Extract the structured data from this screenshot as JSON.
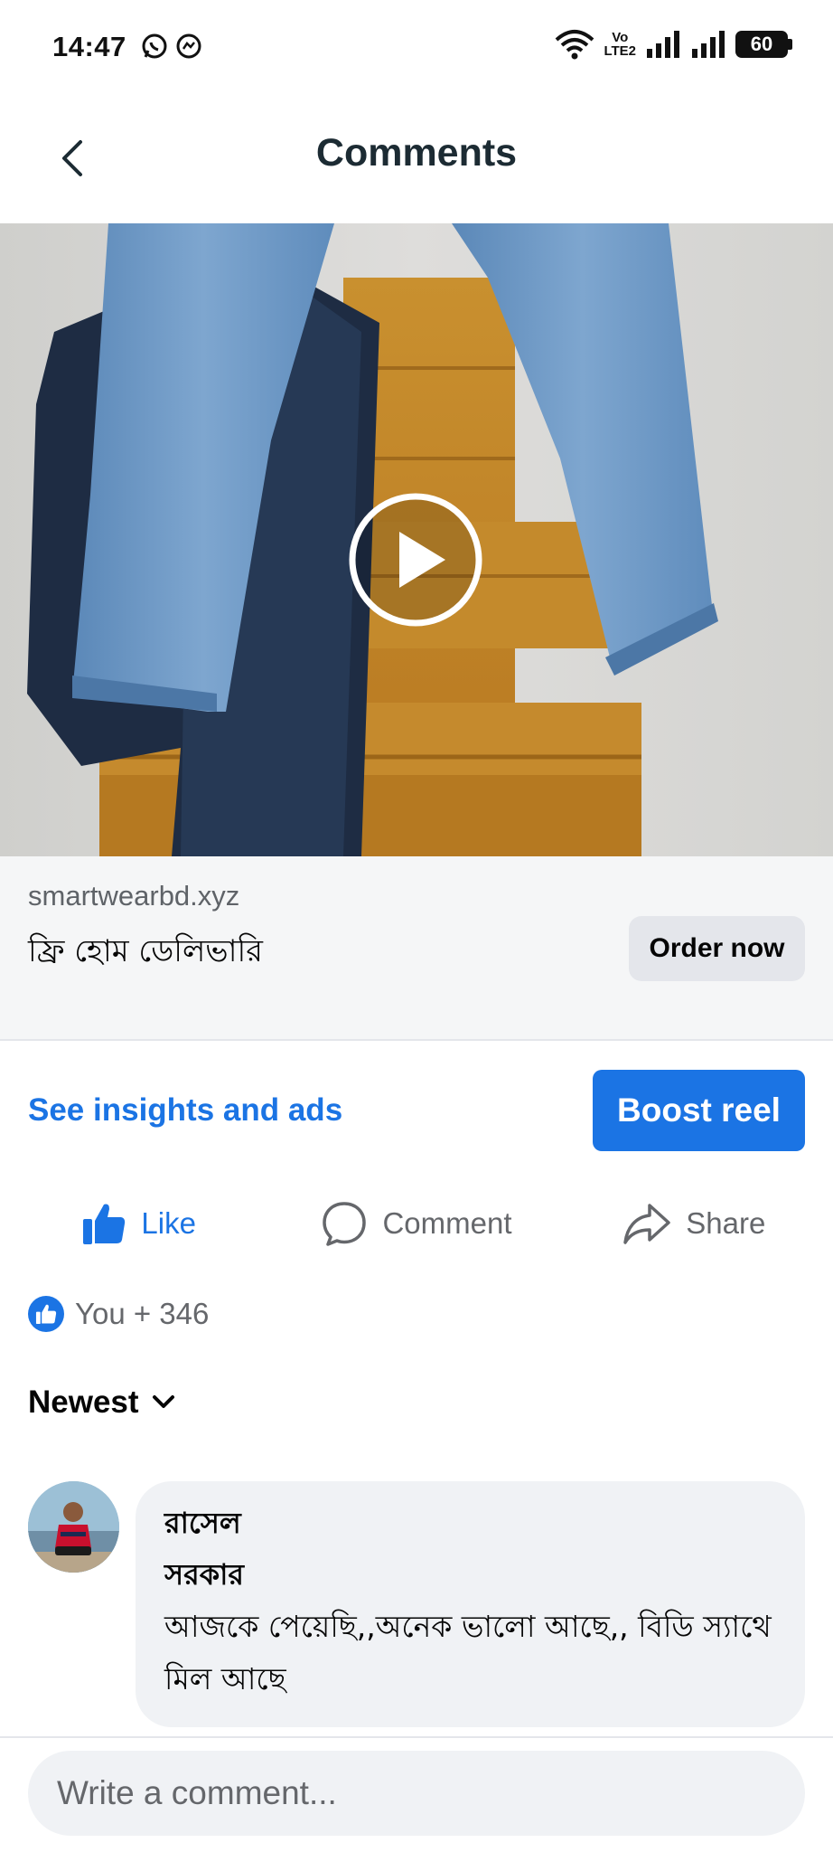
{
  "status_bar": {
    "time": "14:47",
    "volte_top": "Vo",
    "volte_bottom": "LTE2",
    "battery": "60"
  },
  "header": {
    "title": "Comments"
  },
  "ad": {
    "domain": "smartwearbd.xyz",
    "headline": "ফ্রি হোম ডেলিভারি",
    "cta": "Order now"
  },
  "insights": {
    "link": "See insights and ads",
    "boost": "Boost reel"
  },
  "actions": {
    "like": "Like",
    "comment": "Comment",
    "share": "Share"
  },
  "reactions": {
    "summary": "You + 346"
  },
  "sort": {
    "label": "Newest"
  },
  "comments": [
    {
      "author": "রাসেল সরকার",
      "text": "আজকে পেয়েছি,,অনেক ভালো আছে,, বিডি স্যাথে মিল আছে"
    }
  ],
  "composer": {
    "placeholder": "Write a comment..."
  },
  "colors": {
    "accent": "#1b74e4",
    "secondary_text": "#65676b",
    "bubble": "#f0f2f5"
  }
}
